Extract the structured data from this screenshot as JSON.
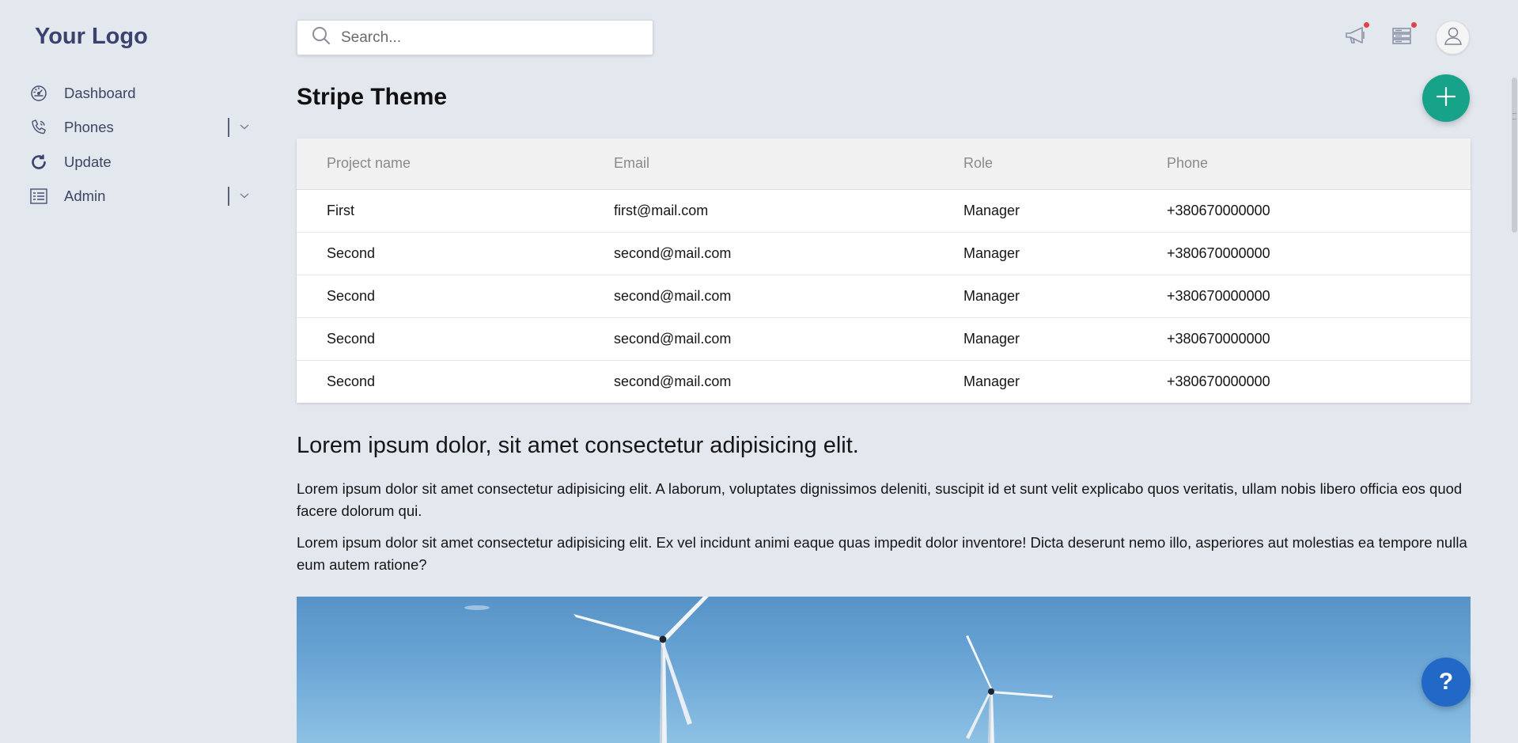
{
  "logo": {
    "text": "Your Logo"
  },
  "sidebar": {
    "items": [
      {
        "label": "Dashboard",
        "icon": "speedometer-icon",
        "has_submenu": false
      },
      {
        "label": "Phones",
        "icon": "phone-icon",
        "has_submenu": true
      },
      {
        "label": "Update",
        "icon": "refresh-icon",
        "has_submenu": false
      },
      {
        "label": "Admin",
        "icon": "list-icon",
        "has_submenu": true
      }
    ]
  },
  "search": {
    "placeholder": "Search...",
    "value": ""
  },
  "header": {
    "title": "Stripe Theme",
    "add_icon": "plus-icon",
    "notifications": [
      {
        "icon": "megaphone-icon",
        "has_dot": true
      },
      {
        "icon": "server-icon",
        "has_dot": true
      }
    ],
    "avatar_icon": "user-icon"
  },
  "table": {
    "columns": [
      "Project name",
      "Email",
      "Role",
      "Phone"
    ],
    "rows": [
      [
        "First",
        "first@mail.com",
        "Manager",
        "+380670000000"
      ],
      [
        "Second",
        "second@mail.com",
        "Manager",
        "+380670000000"
      ],
      [
        "Second",
        "second@mail.com",
        "Manager",
        "+380670000000"
      ],
      [
        "Second",
        "second@mail.com",
        "Manager",
        "+380670000000"
      ],
      [
        "Second",
        "second@mail.com",
        "Manager",
        "+380670000000"
      ]
    ]
  },
  "article": {
    "heading": "Lorem ipsum dolor, sit amet consectetur adipisicing elit.",
    "paragraphs": [
      "Lorem ipsum dolor sit amet consectetur adipisicing elit. A laborum, voluptates dignissimos deleniti, suscipit id et sunt velit explicabo quos veritatis, ullam nobis libero officia eos quod facere dolorum qui.",
      "Lorem ipsum dolor sit amet consectetur adipisicing elit. Ex vel incidunt animi eaque quas impedit dolor inventore! Dicta deserunt nemo illo, asperiores aut molestias ea tempore nulla eum autem ratione?"
    ]
  },
  "help": {
    "label": "?"
  },
  "colors": {
    "background": "#e3e7ee",
    "logo": "#3a4270",
    "accent_green": "#17a38a",
    "help_blue": "#2268c6",
    "notification_dot": "#e2414a"
  }
}
